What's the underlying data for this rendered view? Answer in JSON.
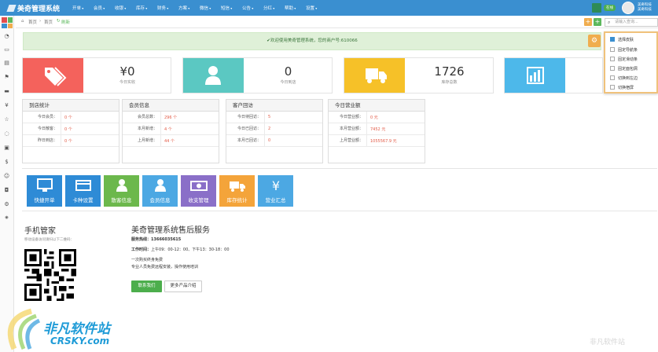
{
  "app": {
    "title": "美奇管理系统"
  },
  "menu": [
    "开单",
    "会员",
    "收银",
    "库存",
    "财务",
    "方案",
    "微信",
    "短信",
    "公告",
    "分红",
    "帮助",
    "设置"
  ],
  "topRight": {
    "badge": "在线",
    "user_line1": "美奇科技",
    "user_line2": "美奇科技"
  },
  "breadcrumb": {
    "home": "首页",
    "page": "首页",
    "refresh": "刷新"
  },
  "search": {
    "placeholder": "请输入查询..."
  },
  "alert": {
    "text": "✔欢迎使用美奇管理系统，您的商户号:610066"
  },
  "dropdown": [
    "选择皮肤",
    "固定导航条",
    "固定滑动条",
    "固定面包屑",
    "切换到左边",
    "切换宿屏"
  ],
  "stats": [
    {
      "value": "¥0",
      "label": "今日实收",
      "color": "#f4625c",
      "icon": "tag-icon"
    },
    {
      "value": "0",
      "label": "今日到店",
      "color": "#5bc8c2",
      "icon": "user-icon"
    },
    {
      "value": "1726",
      "label": "库存总数",
      "color": "#f6c128",
      "icon": "truck-icon"
    },
    {
      "value": "",
      "label": "",
      "color": "#4db8ea",
      "icon": "bar-chart-icon"
    }
  ],
  "panels": [
    {
      "title": "到店统计",
      "rows": [
        [
          "今日会员：",
          "0 个"
        ],
        [
          "今日散客：",
          "0 个"
        ],
        [
          "昨日到店：",
          "0 个"
        ]
      ]
    },
    {
      "title": "会员信息",
      "rows": [
        [
          "会员总数：",
          "296 个"
        ],
        [
          "本月新增：",
          "4 个"
        ],
        [
          "上月新增：",
          "44 个"
        ]
      ]
    },
    {
      "title": "客户回访",
      "rows": [
        [
          "今日待回访：",
          "5"
        ],
        [
          "今日已回访：",
          "2"
        ],
        [
          "本月已回访：",
          "0"
        ]
      ]
    },
    {
      "title": "今日营业额",
      "rows": [
        [
          "今日营业额：",
          "0 元"
        ],
        [
          "本月营业额：",
          "7452 元"
        ],
        [
          "上月营业额：",
          "1055567.9 元"
        ]
      ]
    }
  ],
  "shortcuts": [
    {
      "label": "快捷开单",
      "color": "#2e8bd6",
      "icon": "monitor-icon"
    },
    {
      "label": "卡种设置",
      "color": "#2e8bd6",
      "icon": "card-icon"
    },
    {
      "label": "散客信息",
      "color": "#6cb84c",
      "icon": "guest-icon"
    },
    {
      "label": "会员信息",
      "color": "#4ca8e3",
      "icon": "member-icon"
    },
    {
      "label": "收支管理",
      "color": "#8a6fc8",
      "icon": "money-icon"
    },
    {
      "label": "库存统计",
      "color": "#f4a43a",
      "icon": "truck-icon"
    },
    {
      "label": "营业汇总",
      "color": "#4ca8e3",
      "icon": "yen-icon"
    }
  ],
  "mobile": {
    "title": "手机管家",
    "subtitle": "移动设备访问请扫以下二维码："
  },
  "service": {
    "title": "美奇管理系统售后服务",
    "hotline": "服务热线：13666035615",
    "hours_label": "工作时间：",
    "hours_value": "上午09：00-12：00、下午13：30-18：00",
    "line1": "一次购买终身免费",
    "line2": "专业人员免费远程安装，操作使用培训",
    "contact_btn": "联系我们",
    "more_btn": "更多产品介绍"
  },
  "watermark": {
    "cn": "非凡软件站",
    "en": "CRSKY.com",
    "right": "非凡软件站"
  }
}
